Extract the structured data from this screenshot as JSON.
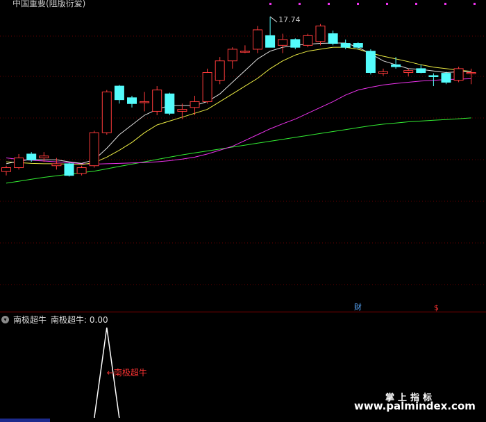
{
  "header": {
    "title": "中国重要(阻版衍爱)"
  },
  "sub_panel": {
    "title": "南极超牛",
    "value_label": "南极超牛: 0.00"
  },
  "markers": {
    "cai": "财",
    "dollar": "$"
  },
  "watermark": {
    "line1": "掌上指标",
    "line2": "www.palmindex.com"
  },
  "colors": {
    "up": "#ff3b3b",
    "down": "#54fcfc",
    "ma5": "#e0e0e0",
    "ma10": "#eeee44",
    "ma20": "#ee33ee",
    "ma60": "#33ee33",
    "signal": "#ffffff",
    "signal_text": "#ff3333",
    "header_dot": "#ee33ee"
  },
  "chart_data": [
    {
      "type": "candlestick",
      "price_range": [
        12.0,
        17.9
      ],
      "annotations": [
        {
          "text": "17.74",
          "candle_index": 21
        }
      ],
      "candles": [
        {
          "o": 13.75,
          "h": 13.9,
          "l": 13.65,
          "c": 13.85
        },
        {
          "o": 13.85,
          "h": 14.2,
          "l": 13.8,
          "c": 14.1
        },
        {
          "o": 14.2,
          "h": 14.25,
          "l": 14.0,
          "c": 14.05
        },
        {
          "o": 14.1,
          "h": 14.25,
          "l": 14.0,
          "c": 14.15
        },
        {
          "o": 13.9,
          "h": 14.1,
          "l": 13.8,
          "c": 13.95
        },
        {
          "o": 13.95,
          "h": 13.98,
          "l": 13.62,
          "c": 13.65
        },
        {
          "o": 13.7,
          "h": 13.9,
          "l": 13.65,
          "c": 13.85
        },
        {
          "o": 13.9,
          "h": 14.8,
          "l": 13.85,
          "c": 14.75
        },
        {
          "o": 14.75,
          "h": 15.85,
          "l": 14.7,
          "c": 15.8
        },
        {
          "o": 15.95,
          "h": 15.98,
          "l": 15.5,
          "c": 15.6
        },
        {
          "o": 15.65,
          "h": 15.7,
          "l": 15.4,
          "c": 15.5
        },
        {
          "o": 15.55,
          "h": 15.8,
          "l": 15.3,
          "c": 15.55
        },
        {
          "o": 15.3,
          "h": 15.95,
          "l": 15.2,
          "c": 15.85
        },
        {
          "o": 15.75,
          "h": 15.78,
          "l": 15.2,
          "c": 15.25
        },
        {
          "o": 15.3,
          "h": 15.5,
          "l": 15.1,
          "c": 15.35
        },
        {
          "o": 15.4,
          "h": 15.7,
          "l": 15.2,
          "c": 15.55
        },
        {
          "o": 15.55,
          "h": 16.4,
          "l": 15.5,
          "c": 16.3
        },
        {
          "o": 16.1,
          "h": 16.7,
          "l": 16.0,
          "c": 16.6
        },
        {
          "o": 16.6,
          "h": 16.95,
          "l": 16.4,
          "c": 16.9
        },
        {
          "o": 16.85,
          "h": 17.0,
          "l": 16.8,
          "c": 16.85
        },
        {
          "o": 16.9,
          "h": 17.5,
          "l": 16.8,
          "c": 17.4
        },
        {
          "o": 17.25,
          "h": 17.74,
          "l": 16.95,
          "c": 16.95
        },
        {
          "o": 17.0,
          "h": 17.3,
          "l": 16.8,
          "c": 17.15
        },
        {
          "o": 17.15,
          "h": 17.18,
          "l": 16.9,
          "c": 16.95
        },
        {
          "o": 17.0,
          "h": 17.3,
          "l": 16.95,
          "c": 17.25
        },
        {
          "o": 17.1,
          "h": 17.55,
          "l": 17.0,
          "c": 17.5
        },
        {
          "o": 17.3,
          "h": 17.38,
          "l": 17.0,
          "c": 17.05
        },
        {
          "o": 17.05,
          "h": 17.15,
          "l": 16.9,
          "c": 16.95
        },
        {
          "o": 17.05,
          "h": 17.08,
          "l": 16.9,
          "c": 16.95
        },
        {
          "o": 16.85,
          "h": 16.9,
          "l": 16.25,
          "c": 16.3
        },
        {
          "o": 16.28,
          "h": 16.4,
          "l": 16.22,
          "c": 16.32
        },
        {
          "o": 16.5,
          "h": 16.7,
          "l": 16.4,
          "c": 16.45
        },
        {
          "o": 16.3,
          "h": 16.4,
          "l": 16.2,
          "c": 16.35
        },
        {
          "o": 16.4,
          "h": 16.5,
          "l": 16.28,
          "c": 16.3
        },
        {
          "o": 16.22,
          "h": 16.28,
          "l": 15.95,
          "c": 16.2
        },
        {
          "o": 16.28,
          "h": 16.32,
          "l": 16.0,
          "c": 16.05
        },
        {
          "o": 16.1,
          "h": 16.45,
          "l": 16.05,
          "c": 16.4
        },
        {
          "o": 16.3,
          "h": 16.4,
          "l": 16.0,
          "c": 16.3
        }
      ],
      "ma5": [
        13.95,
        14.02,
        14.06,
        14.05,
        14.05,
        14.0,
        13.96,
        14.05,
        14.35,
        14.7,
        14.95,
        15.2,
        15.35,
        15.45,
        15.45,
        15.45,
        15.55,
        15.75,
        16.05,
        16.35,
        16.65,
        16.85,
        16.95,
        17.0,
        17.03,
        17.05,
        17.06,
        17.06,
        16.95,
        16.78,
        16.6,
        16.5,
        16.4,
        16.38,
        16.34,
        16.3,
        16.32,
        16.33
      ],
      "ma10": [
        14.0,
        13.98,
        13.96,
        13.95,
        13.95,
        13.94,
        13.93,
        13.98,
        14.12,
        14.3,
        14.5,
        14.75,
        14.95,
        15.05,
        15.15,
        15.25,
        15.35,
        15.55,
        15.75,
        15.95,
        16.15,
        16.4,
        16.6,
        16.75,
        16.85,
        16.9,
        16.95,
        16.95,
        16.9,
        16.8,
        16.72,
        16.65,
        16.58,
        16.5,
        16.44,
        16.4,
        16.36,
        16.33
      ],
      "ma20": [
        14.1,
        14.06,
        14.04,
        14.02,
        14.0,
        13.98,
        13.95,
        13.94,
        13.95,
        13.96,
        13.97,
        13.98,
        14.0,
        14.03,
        14.07,
        14.12,
        14.2,
        14.3,
        14.4,
        14.55,
        14.7,
        14.85,
        14.98,
        15.1,
        15.25,
        15.4,
        15.55,
        15.72,
        15.85,
        15.92,
        15.98,
        16.02,
        16.05,
        16.08,
        16.1,
        16.12,
        16.13,
        16.14
      ],
      "ma60": [
        13.45,
        13.5,
        13.55,
        13.6,
        13.64,
        13.68,
        13.72,
        13.76,
        13.82,
        13.88,
        13.94,
        14.0,
        14.06,
        14.12,
        14.18,
        14.23,
        14.28,
        14.33,
        14.38,
        14.43,
        14.48,
        14.53,
        14.58,
        14.63,
        14.68,
        14.73,
        14.78,
        14.83,
        14.88,
        14.93,
        14.97,
        15.0,
        15.03,
        15.05,
        15.07,
        15.09,
        15.11,
        15.13
      ]
    },
    {
      "type": "line",
      "title": "南极超牛",
      "y_range": [
        0,
        1
      ],
      "values": [
        0,
        0,
        0,
        0,
        0,
        0,
        0,
        0,
        1,
        0,
        0,
        0,
        0,
        0,
        0,
        0,
        0,
        0,
        0,
        0,
        0,
        0,
        0,
        0,
        0,
        0,
        0,
        0,
        0,
        0,
        0,
        0,
        0,
        0,
        0,
        0,
        0,
        0
      ],
      "annotations": [
        {
          "text": "←南极超牛",
          "index": 8
        }
      ]
    }
  ]
}
